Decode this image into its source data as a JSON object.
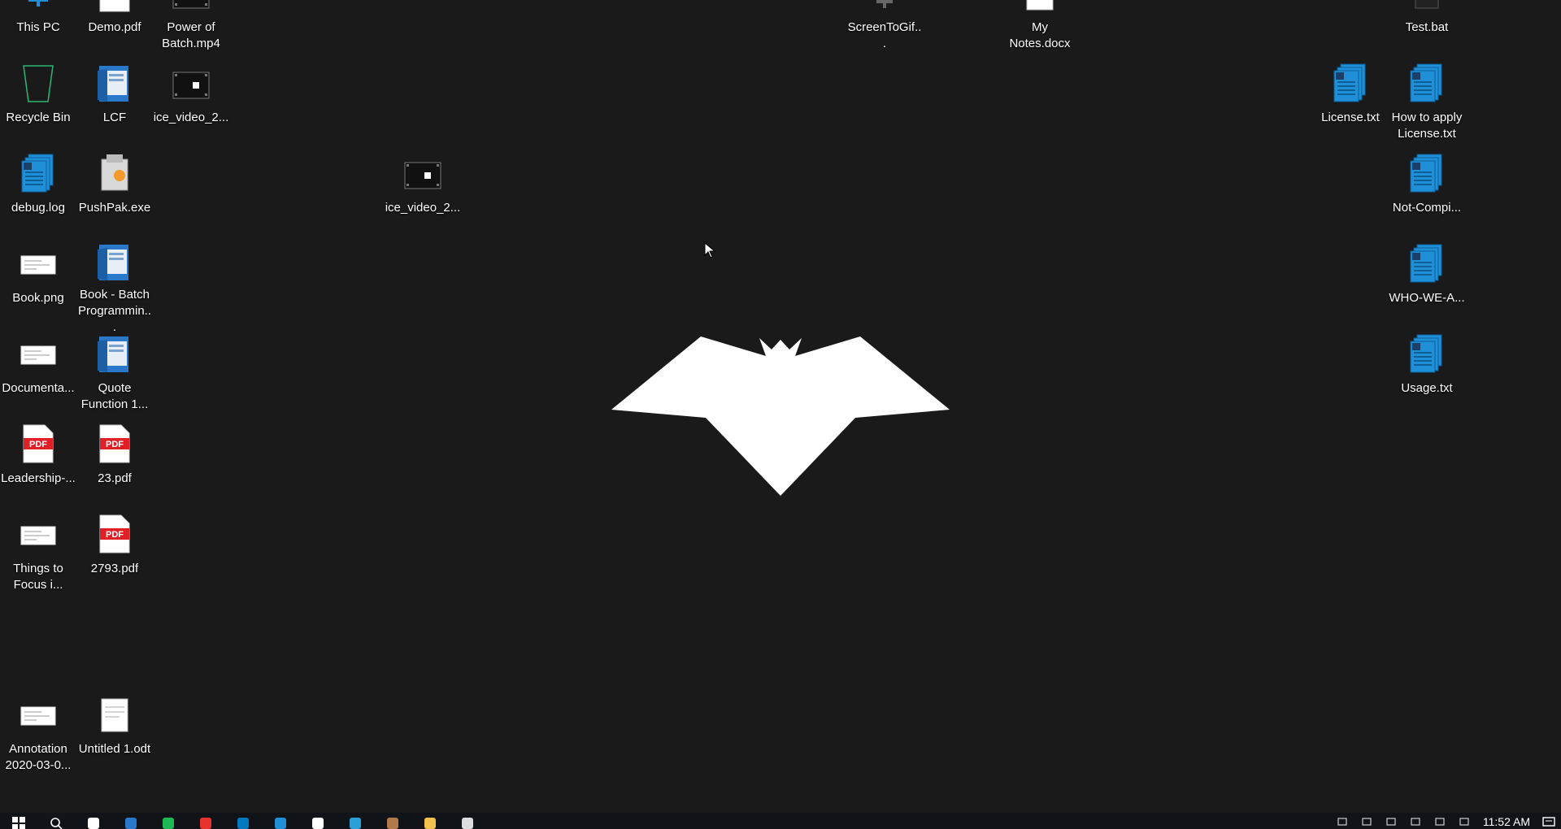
{
  "desktop": {
    "icons": [
      {
        "label": "This PC",
        "icon": "this-pc-icon"
      },
      {
        "label": "Demo.pdf",
        "icon": "pdf-file-icon"
      },
      {
        "label": "Power of Batch.mp4",
        "icon": "video-file-icon"
      },
      {
        "label": "ScreenToGif...",
        "icon": "app-shortcut-icon"
      },
      {
        "label": "My Notes.docx",
        "icon": "document-icon"
      },
      {
        "label": "Test.bat",
        "icon": "batch-file-icon"
      },
      {
        "label": "Recycle Bin",
        "icon": "recycle-bin-icon"
      },
      {
        "label": "LCF",
        "icon": "folder-icon"
      },
      {
        "label": "ice_video_2...",
        "icon": "video-file-icon"
      },
      {
        "label": "License.txt",
        "icon": "text-file-icon"
      },
      {
        "label": "How to apply License.txt",
        "icon": "text-file-icon"
      },
      {
        "label": "debug.log",
        "icon": "text-file-icon"
      },
      {
        "label": "PushPak.exe",
        "icon": "installer-icon"
      },
      {
        "label": "ice_video_2...",
        "icon": "video-file-icon"
      },
      {
        "label": "Not-Compi...",
        "icon": "text-file-icon"
      },
      {
        "label": "Book.png",
        "icon": "image-file-icon"
      },
      {
        "label": "Book - Batch Programmin...",
        "icon": "folder-icon"
      },
      {
        "label": "WHO-WE-A...",
        "icon": "text-file-icon"
      },
      {
        "label": "Documenta...",
        "icon": "image-file-icon"
      },
      {
        "label": "Quote Function 1...",
        "icon": "folder-icon"
      },
      {
        "label": "Usage.txt",
        "icon": "text-file-icon"
      },
      {
        "label": "Leadership-...",
        "icon": "pdf-file-icon"
      },
      {
        "label": "23.pdf",
        "icon": "pdf-file-icon"
      },
      {
        "label": "Things to Focus i...",
        "icon": "image-file-icon"
      },
      {
        "label": "2793.pdf",
        "icon": "pdf-file-icon"
      },
      {
        "label": "Annotation 2020-03-0...",
        "icon": "image-file-icon"
      },
      {
        "label": "Untitled 1.odt",
        "icon": "document-icon"
      }
    ],
    "pdf_badge": "PDF",
    "wallpaper": "bat-logo-icon"
  },
  "taskbar": {
    "items": [
      "windows-start-icon",
      "search-icon",
      "task-view-icon",
      "mail-icon",
      "spotify-icon",
      "todo-icon",
      "trello-icon",
      "edge-icon",
      "store-icon",
      "vscode-icon",
      "app-icon",
      "file-explorer-icon",
      "notepad-icon"
    ],
    "tray": [
      "chevron-up-icon",
      "keyboard-icon",
      "battery-icon",
      "wifi-icon",
      "volume-icon",
      "language-icon"
    ],
    "clock": "11:52 AM",
    "notifications": "notification-icon"
  },
  "colors": {
    "desktop_bg": "#1a1a1a",
    "taskbar_bg": "#101418",
    "text_file_blue": "#1f8fd8",
    "pdf_red": "#e01f26",
    "folder_blue": "#2a78c9",
    "recycle_green": "#2bb673"
  }
}
